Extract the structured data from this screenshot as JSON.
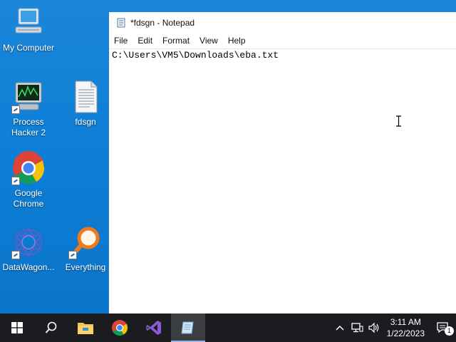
{
  "desktop": {
    "icons": [
      {
        "label": "My Computer"
      },
      {
        "label": "Process Hacker 2"
      },
      {
        "label": "fdsgn"
      },
      {
        "label": "Google Chrome"
      },
      {
        "label": "DataWagon..."
      },
      {
        "label": "Everything"
      }
    ]
  },
  "notepad": {
    "title": "*fdsgn - Notepad",
    "menu": [
      "File",
      "Edit",
      "Format",
      "View",
      "Help"
    ],
    "content": "C:\\Users\\VM5\\Downloads\\eba.txt"
  },
  "taskbar": {
    "time": "3:11 AM",
    "date": "1/22/2023",
    "notification_count": "1"
  }
}
